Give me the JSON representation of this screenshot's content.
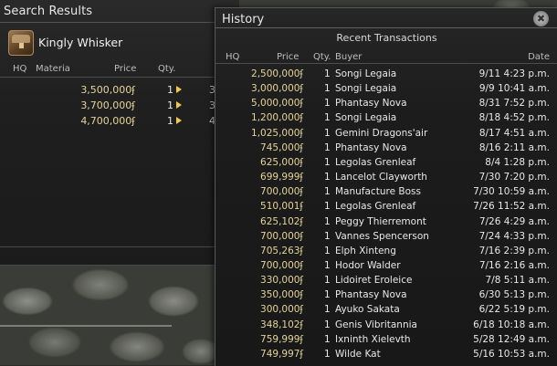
{
  "search": {
    "title": "Search Results",
    "item_name": "Kingly Whisker",
    "headers": {
      "hq": "HQ",
      "materia": "Materia",
      "price": "Price",
      "qty": "Qty."
    },
    "rows": [
      {
        "price": "3,500,000ʄ",
        "qty": "1",
        "cut": "3"
      },
      {
        "price": "3,700,000ʄ",
        "qty": "1",
        "cut": "3"
      },
      {
        "price": "4,700,000ʄ",
        "qty": "1",
        "cut": "4"
      }
    ]
  },
  "history": {
    "title": "History",
    "subtitle": "Recent Transactions",
    "close_icon": "✖",
    "headers": {
      "hq": "HQ",
      "price": "Price",
      "qty": "Qty.",
      "buyer": "Buyer",
      "date": "Date"
    },
    "rows": [
      {
        "price": "2,500,000ʄ",
        "qty": "1",
        "buyer": "Songi Legaia",
        "date": "9/11 4:23 p.m."
      },
      {
        "price": "3,000,000ʄ",
        "qty": "1",
        "buyer": "Songi Legaia",
        "date": "9/9 10:41 a.m."
      },
      {
        "price": "5,000,000ʄ",
        "qty": "1",
        "buyer": "Phantasy Nova",
        "date": "8/31 7:52 p.m."
      },
      {
        "price": "1,200,000ʄ",
        "qty": "1",
        "buyer": "Songi Legaia",
        "date": "8/18 4:52 p.m."
      },
      {
        "price": "1,025,000ʄ",
        "qty": "1",
        "buyer": "Gemini Dragons'air",
        "date": "8/17 4:51 a.m."
      },
      {
        "price": "745,000ʄ",
        "qty": "1",
        "buyer": "Phantasy Nova",
        "date": "8/16 2:11 a.m."
      },
      {
        "price": "625,000ʄ",
        "qty": "1",
        "buyer": "Legolas Grenleaf",
        "date": "8/4 1:28 p.m."
      },
      {
        "price": "699,999ʄ",
        "qty": "1",
        "buyer": "Lancelot Clayworth",
        "date": "7/30 7:20 p.m."
      },
      {
        "price": "700,000ʄ",
        "qty": "1",
        "buyer": "Manufacture Boss",
        "date": "7/30 10:59 a.m."
      },
      {
        "price": "510,001ʄ",
        "qty": "1",
        "buyer": "Legolas Grenleaf",
        "date": "7/26 11:52 a.m."
      },
      {
        "price": "625,102ʄ",
        "qty": "1",
        "buyer": "Peggy Thierremont",
        "date": "7/26 4:29 a.m."
      },
      {
        "price": "700,000ʄ",
        "qty": "1",
        "buyer": "Vannes Spencerson",
        "date": "7/24 4:33 p.m."
      },
      {
        "price": "705,263ʄ",
        "qty": "1",
        "buyer": "Elph Xinteng",
        "date": "7/16 2:39 p.m."
      },
      {
        "price": "700,000ʄ",
        "qty": "1",
        "buyer": "Hodor Walder",
        "date": "7/16 2:16 a.m."
      },
      {
        "price": "330,000ʄ",
        "qty": "1",
        "buyer": "Lidoiret Eroleice",
        "date": "7/8 5:11 a.m."
      },
      {
        "price": "350,000ʄ",
        "qty": "1",
        "buyer": "Phantasy Nova",
        "date": "6/30 5:13 p.m."
      },
      {
        "price": "300,000ʄ",
        "qty": "1",
        "buyer": "Ayuko Sakata",
        "date": "6/22 5:19 p.m."
      },
      {
        "price": "348,102ʄ",
        "qty": "1",
        "buyer": "Genis Vibritannia",
        "date": "6/18 10:18 a.m."
      },
      {
        "price": "759,999ʄ",
        "qty": "1",
        "buyer": "Ixninth Xielevth",
        "date": "5/28 12:49 a.m."
      },
      {
        "price": "749,997ʄ",
        "qty": "1",
        "buyer": "Wilde Kat",
        "date": "5/16 10:53 a.m."
      }
    ]
  },
  "colors": {
    "price": "#e4d39a",
    "arrow": "#f0c84a"
  }
}
